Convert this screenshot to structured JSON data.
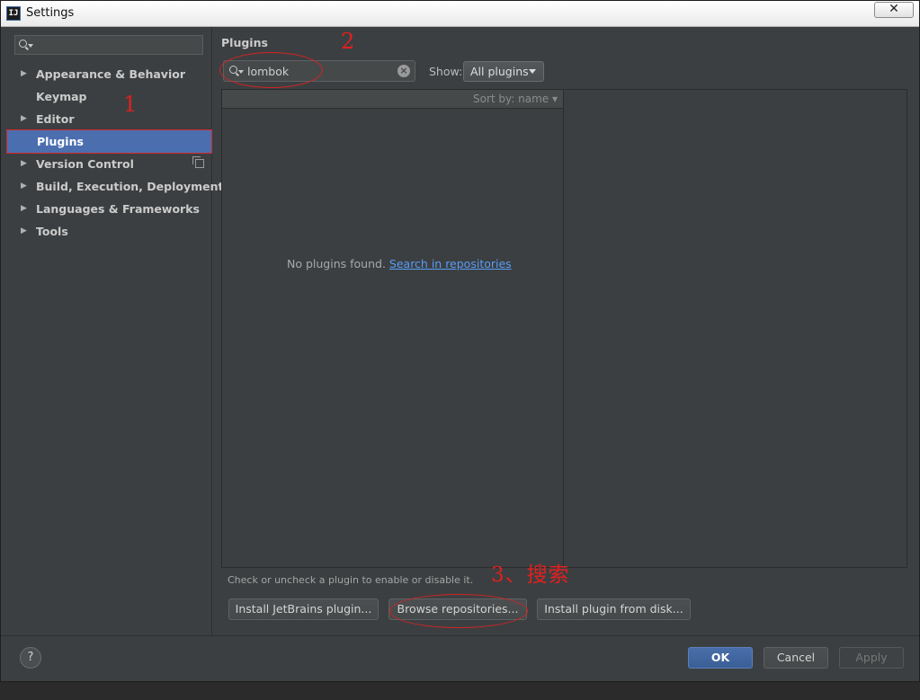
{
  "window": {
    "title": "Settings",
    "app_icon_text": "IJ",
    "close_glyph": "✕"
  },
  "sidebar": {
    "search_value": "",
    "items": [
      {
        "label": "Appearance & Behavior",
        "expandable": true
      },
      {
        "label": "Keymap",
        "expandable": false
      },
      {
        "label": "Editor",
        "expandable": true
      },
      {
        "label": "Plugins",
        "expandable": false,
        "selected": true
      },
      {
        "label": "Version Control",
        "expandable": true,
        "has_project_icon": true
      },
      {
        "label": "Build, Execution, Deployment",
        "expandable": true
      },
      {
        "label": "Languages & Frameworks",
        "expandable": true
      },
      {
        "label": "Tools",
        "expandable": true
      }
    ]
  },
  "plugins": {
    "title": "Plugins",
    "search_value": "lombok",
    "show_label": "Show:",
    "show_selected": "All plugins",
    "sort_label": "Sort by: name",
    "empty_text": "No plugins found.",
    "empty_link": "Search in repositories",
    "hint": "Check or uncheck a plugin to enable or disable it.",
    "buttons": {
      "install_jetbrains": "Install JetBrains plugin...",
      "browse": "Browse repositories...",
      "install_disk": "Install plugin from disk..."
    }
  },
  "footer": {
    "help": "?",
    "ok": "OK",
    "cancel": "Cancel",
    "apply": "Apply"
  },
  "annotations": {
    "one": "1",
    "two": "2",
    "three": "3、搜索"
  },
  "colors": {
    "selection": "#4b6eaf",
    "annotation": "#e02020",
    "link": "#589df6",
    "background": "#3c3f41"
  }
}
